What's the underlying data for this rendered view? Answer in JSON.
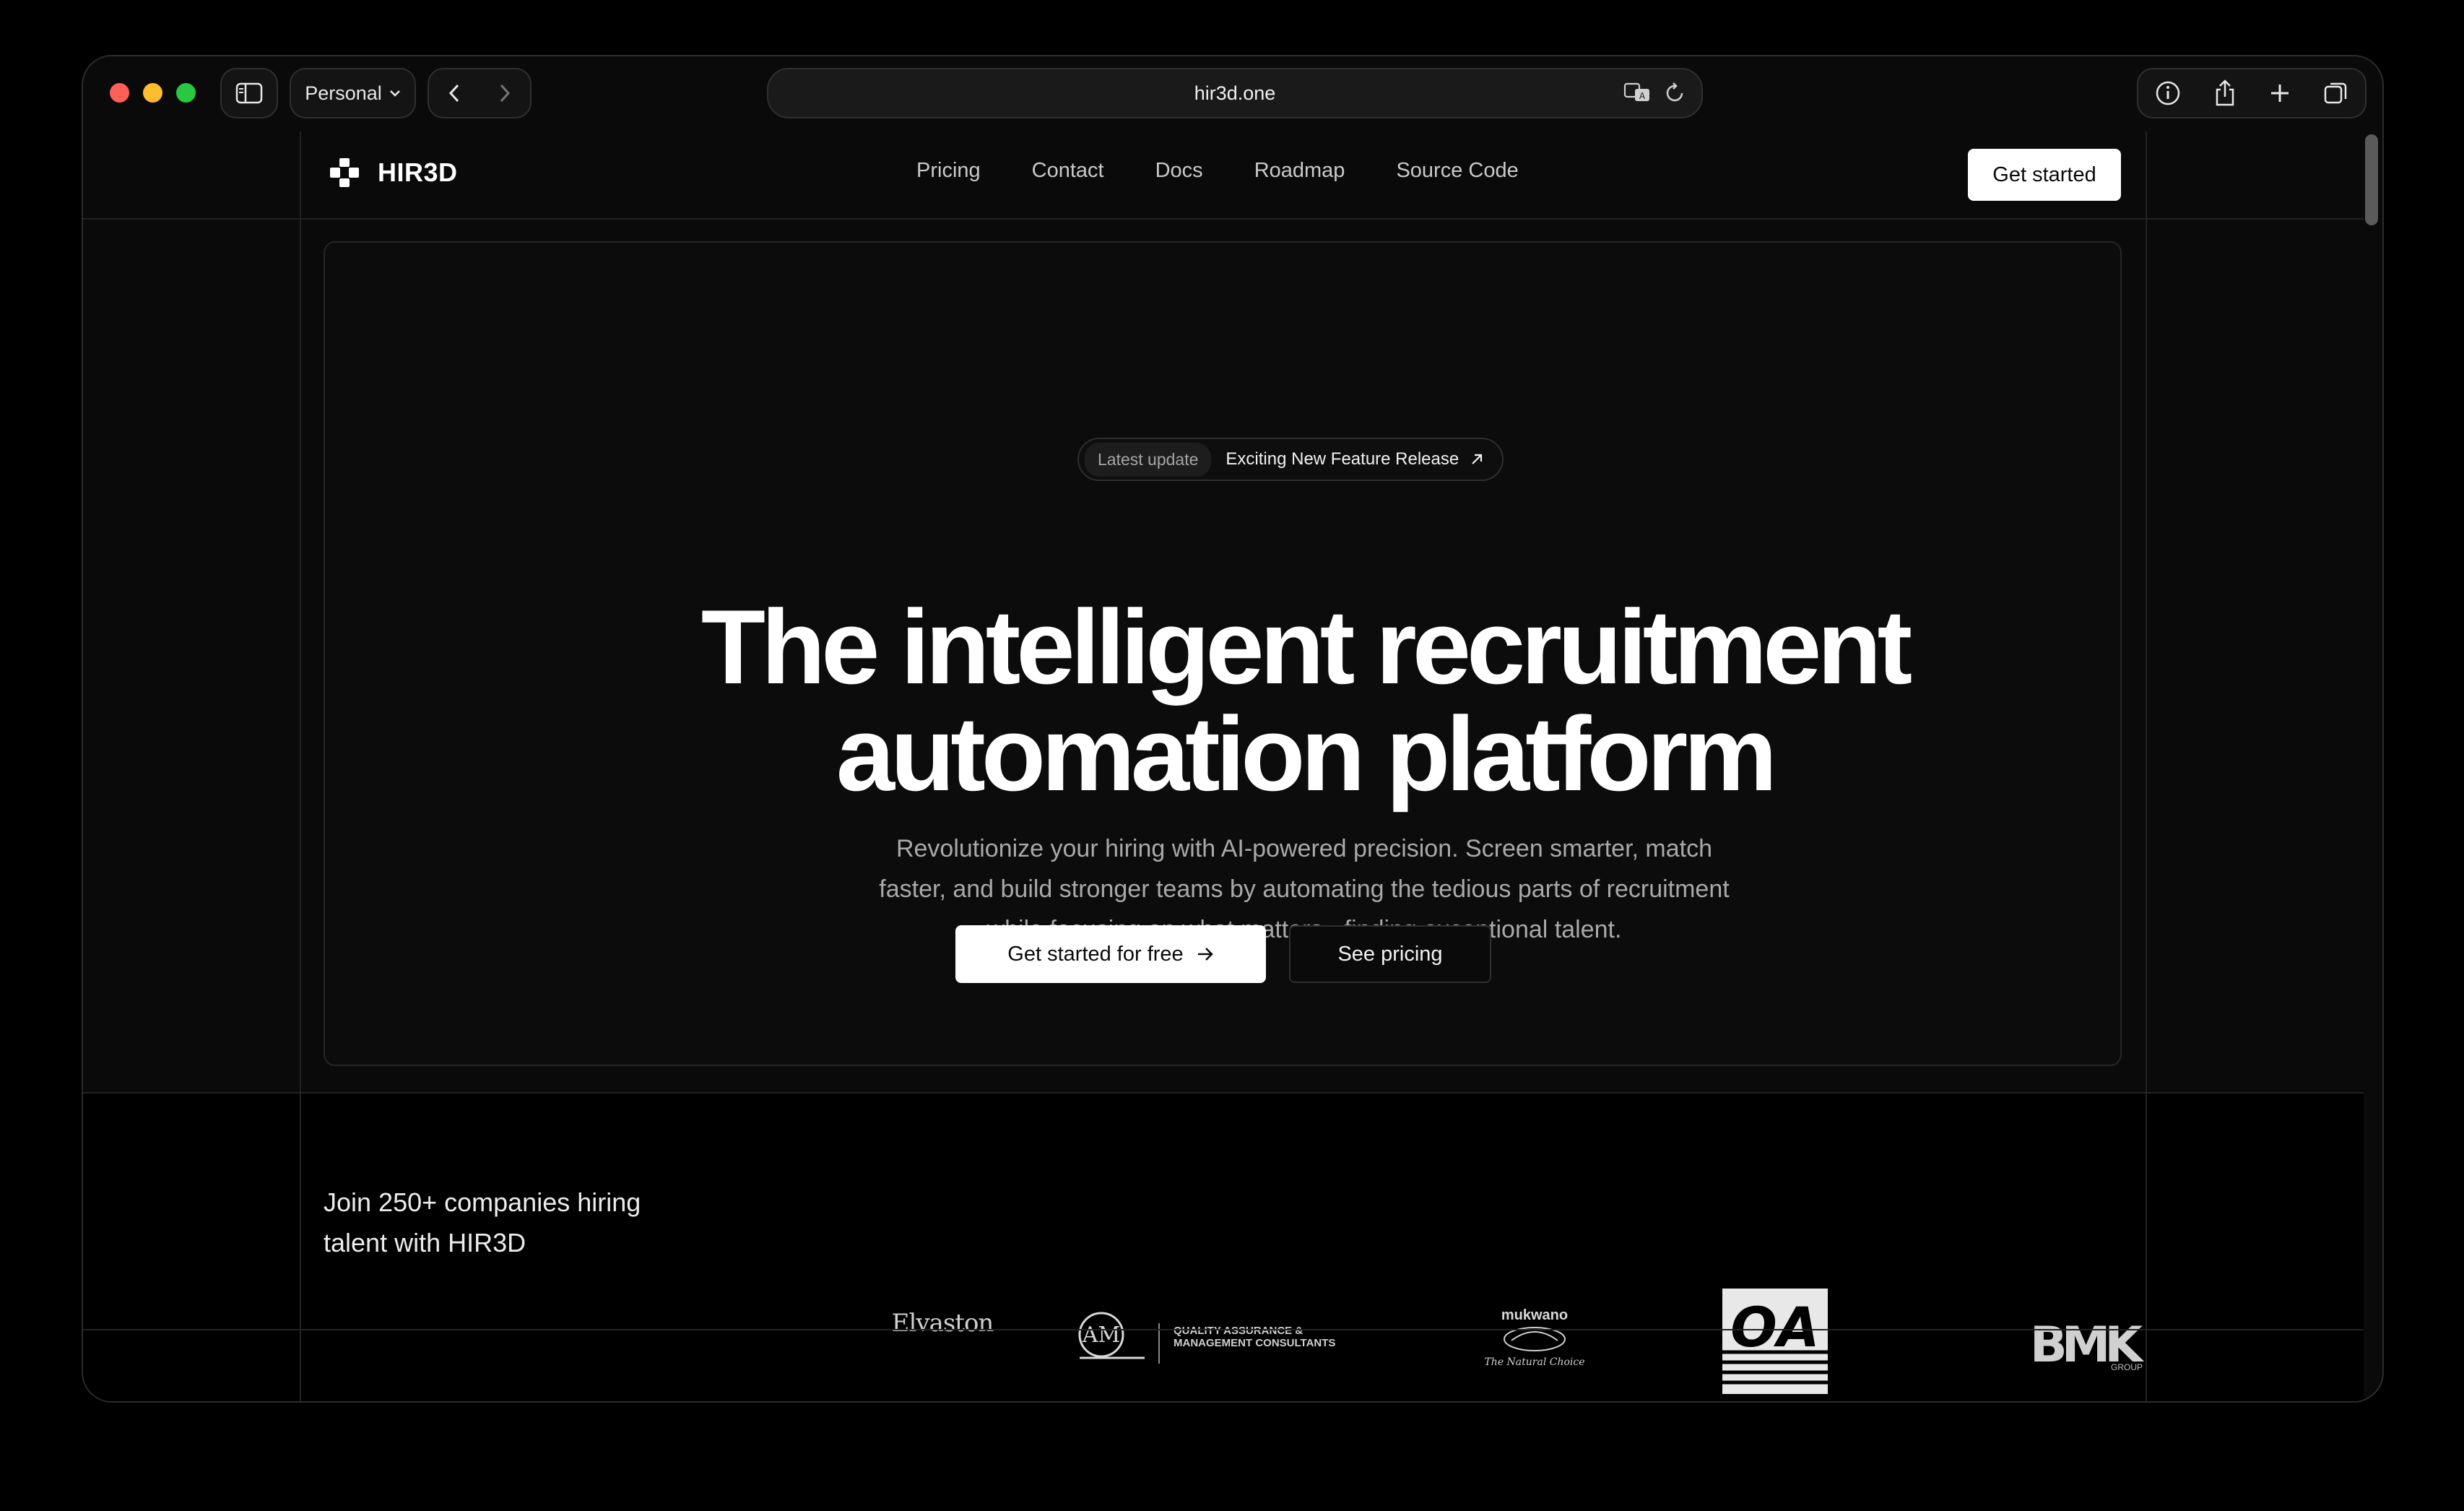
{
  "browser": {
    "profile": "Personal",
    "url": "hir3d.one"
  },
  "site": {
    "brand": "HIR3D",
    "nav": [
      "Pricing",
      "Contact",
      "Docs",
      "Roadmap",
      "Source Code"
    ],
    "header_cta": "Get started"
  },
  "hero": {
    "update_tag": "Latest update",
    "update_msg": "Exciting New Feature Release",
    "headline_line1": "The intelligent recruitment",
    "headline_line2": "automation platform",
    "subtext": "Revolutionize your hiring with AI-powered precision. Screen smarter, match faster, and build stronger teams by automating the tedious parts of recruitment while focusing on what matters - finding exceptional talent.",
    "primary_cta": "Get started for free",
    "secondary_cta": "See pricing"
  },
  "social_proof": {
    "text": "Join 250+ companies hiring talent with HIR3D",
    "companies": [
      {
        "name": "Elvaston"
      },
      {
        "name": "QUALITY ASSURANCE & MANAGEMENT CONSULTANTS"
      },
      {
        "name": "mukwano",
        "tagline": "The Natural Choice"
      },
      {
        "name": "OA"
      },
      {
        "name": "BMK",
        "tagline": "GROUP"
      }
    ]
  },
  "icons": {
    "sidebar": "sidebar-toggle-icon",
    "profile_chevron": "chevron-down-icon",
    "back": "chevron-left-icon",
    "forward": "chevron-right-icon",
    "translate": "translate-icon",
    "reload": "reload-icon",
    "info": "info-icon",
    "share": "share-icon",
    "new_tab": "plus-icon",
    "tabs": "tabs-overview-icon",
    "logo": "hir3d-logo-icon",
    "external": "arrow-up-right-icon",
    "arrow": "arrow-right-icon"
  }
}
